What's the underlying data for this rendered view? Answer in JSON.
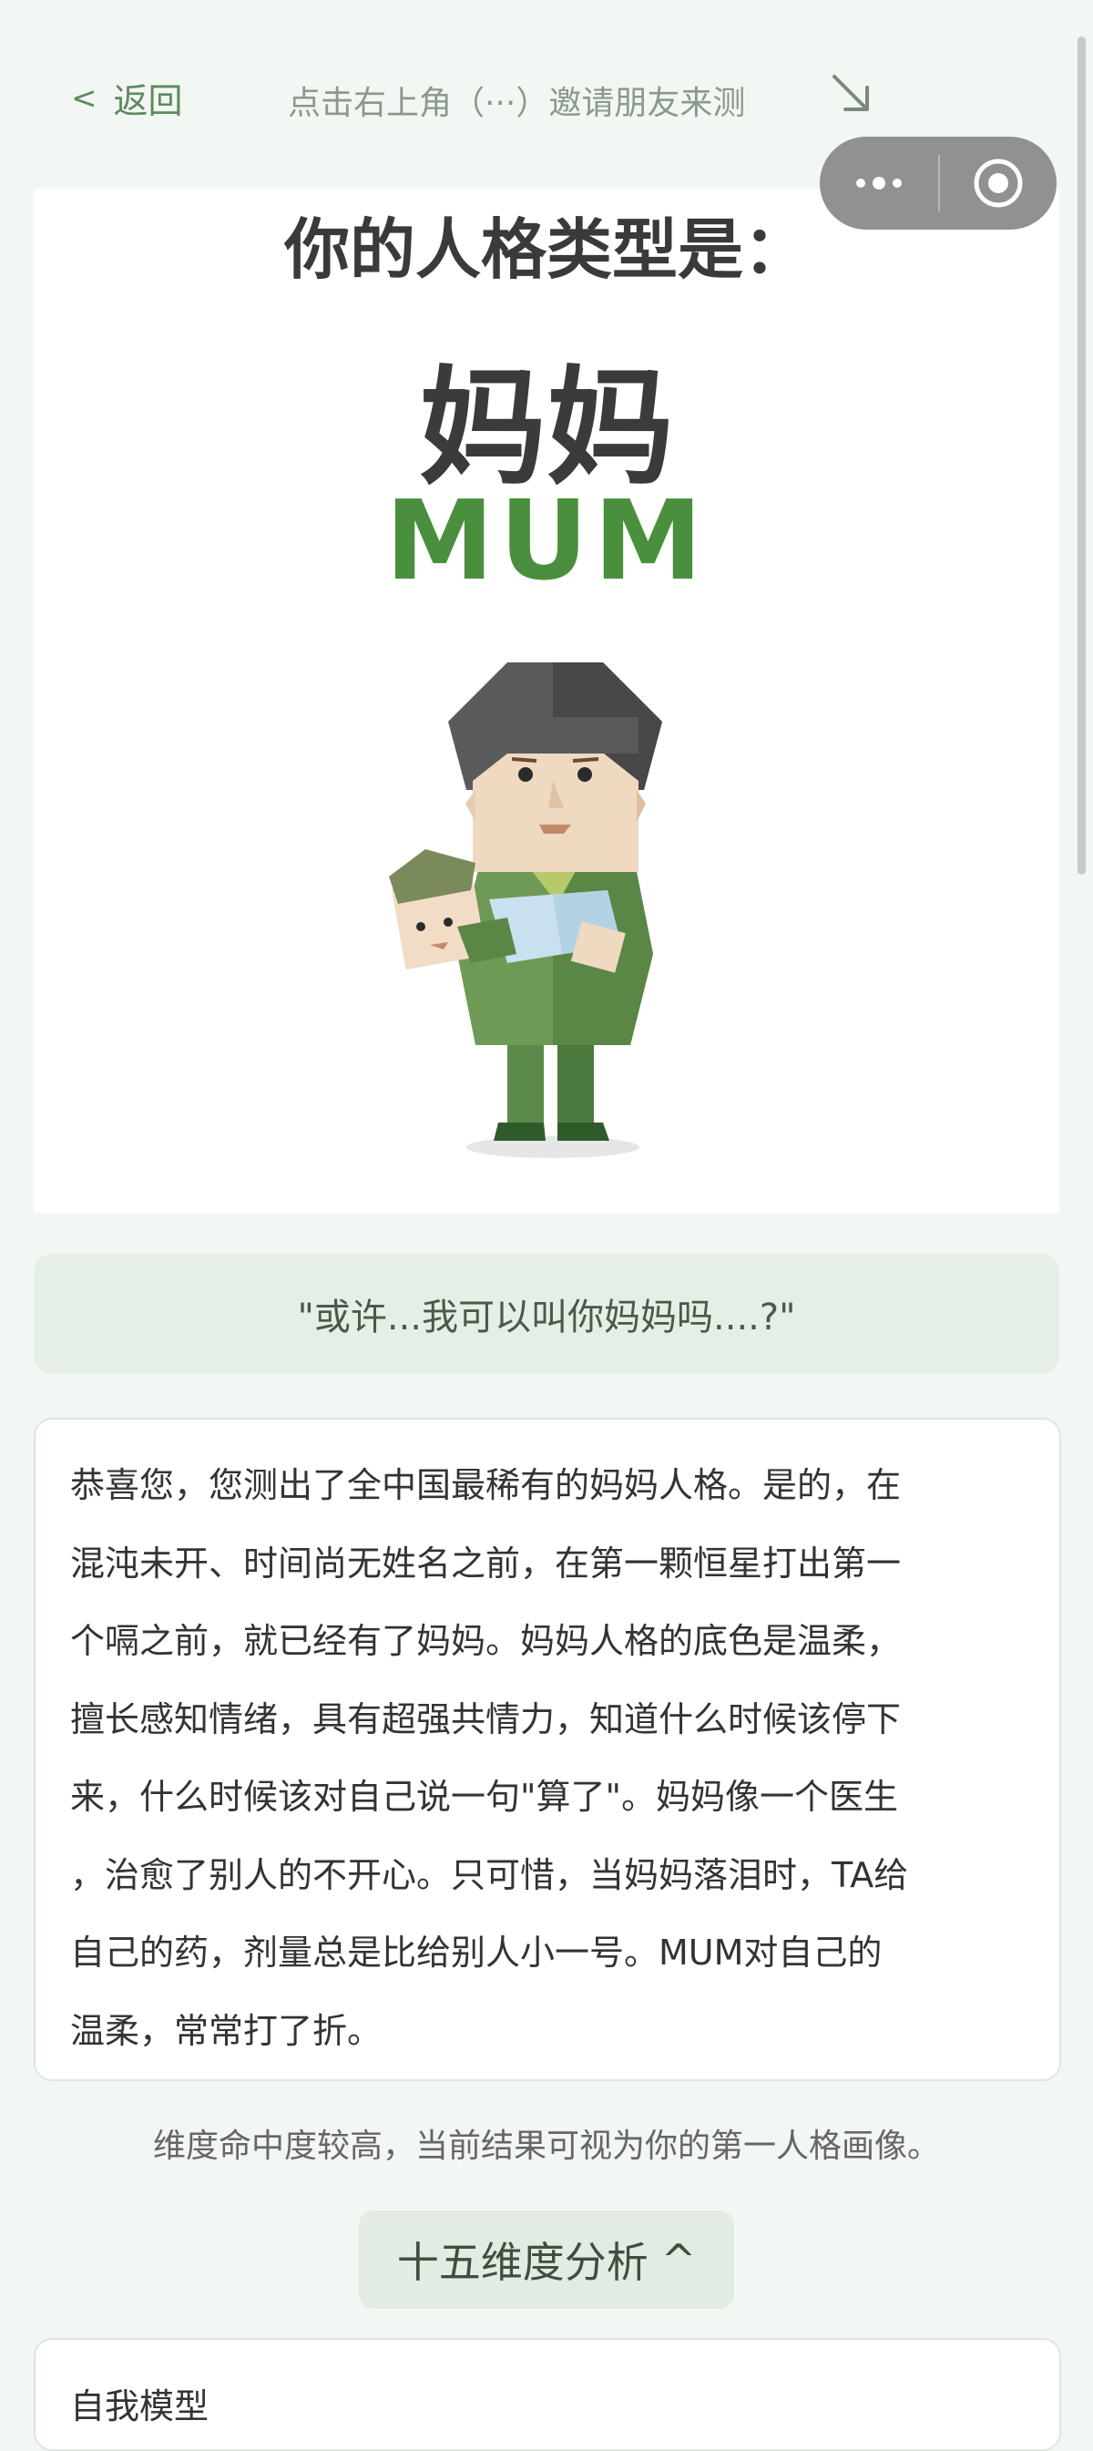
{
  "nav": {
    "back_label": "返回",
    "invite_text": "点击右上角（···）邀请朋友来测"
  },
  "result": {
    "heading": "你的人格类型是：",
    "type_cn": "妈妈",
    "type_en": "MUM"
  },
  "quote": "\"或许...我可以叫你妈妈吗....?\"",
  "description": "恭喜您，您测出了全中国最稀有的妈妈人格。是的，在\n混沌未开、时间尚无姓名之前，在第一颗恒星打出第一\n个嗝之前，就已经有了妈妈。妈妈人格的底色是温柔，\n擅长感知情绪，具有超强共情力，知道什么时候该停下\n来，什么时候该对自己说一句\"算了\"。妈妈像一个医生\n，治愈了别人的不开心。只可惜，当妈妈落泪时，TA给\n自己的药，剂量总是比给别人小一号。MUM对自己的\n温柔，常常打了折。",
  "confidence_text": "维度命中度较高，当前结果可视为你的第一人格画像。",
  "analysis_button": {
    "label": "十五维度分析",
    "icon": "chevron-up-icon"
  },
  "dimension_section_title": "自我模型",
  "colors": {
    "accent_green": "#4a8f3e",
    "background": "#f3f7f3",
    "quote_bg": "#e6efe6"
  }
}
